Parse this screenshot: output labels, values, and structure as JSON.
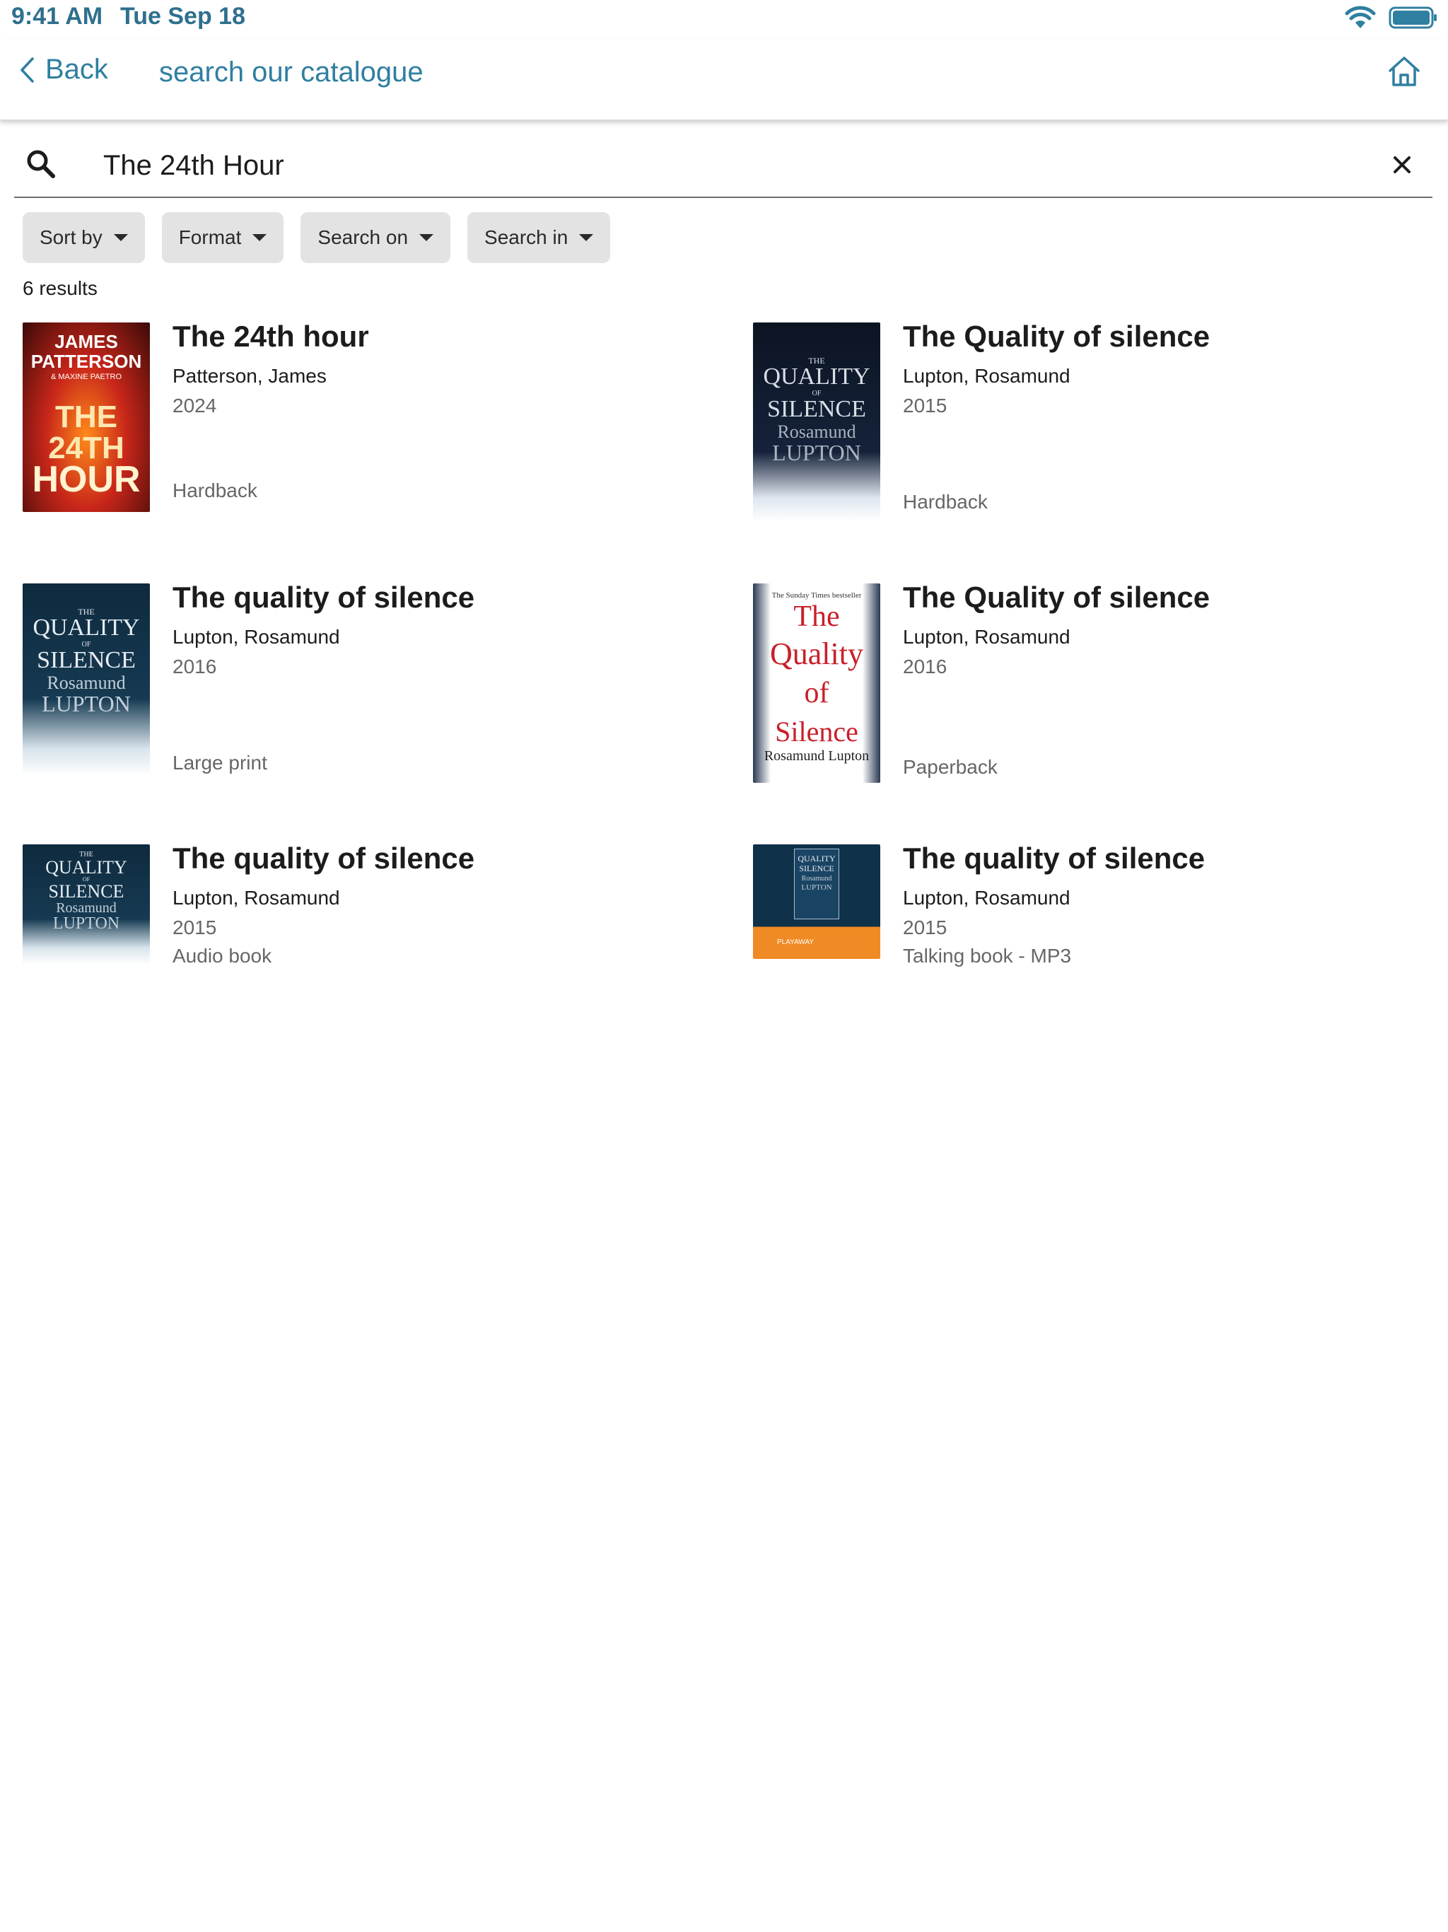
{
  "status_bar": {
    "time": "9:41 AM",
    "date": "Tue Sep 18",
    "wifi_icon": "wifi-icon",
    "battery_icon": "battery-icon"
  },
  "nav": {
    "back_label": "Back",
    "title": "search our catalogue",
    "home_icon": "home-icon"
  },
  "search": {
    "value": "The 24th Hour",
    "clear_icon": "close-icon"
  },
  "filters": [
    {
      "label": "Sort by"
    },
    {
      "label": "Format"
    },
    {
      "label": "Search on"
    },
    {
      "label": "Search in"
    }
  ],
  "results_count": "6 results",
  "results": [
    {
      "title": "The 24th hour",
      "author": "Patterson, James",
      "year": "2024",
      "format": "Hardback",
      "cover": {
        "line1": "JAMES",
        "line2": "PATTERSON",
        "line3": "& MAXINE PAETRO",
        "line4": "THE 24TH",
        "line5": "HOUR"
      }
    },
    {
      "title": "The Quality of silence",
      "author": "Lupton, Rosamund",
      "year": "2015",
      "format": "Hardback",
      "cover": {
        "line1": "THE",
        "line2": "QUALITY",
        "line3": "OF",
        "line4": "SILENCE",
        "line5": "Rosamund",
        "line6": "LUPTON"
      }
    },
    {
      "title": "The quality of silence",
      "author": "Lupton, Rosamund",
      "year": "2016",
      "format": "Large print",
      "cover": {
        "line1": "THE",
        "line2": "QUALITY",
        "line3": "OF",
        "line4": "SILENCE",
        "line5": "Rosamund",
        "line6": "LUPTON"
      }
    },
    {
      "title": "The Quality of silence",
      "author": "Lupton, Rosamund",
      "year": "2016",
      "format": "Paperback",
      "cover": {
        "line0": "The Sunday Times bestseller",
        "line1": "The",
        "line2": "Quality",
        "line3": "of",
        "line4": "Silence",
        "line5": "Rosamund Lupton"
      }
    },
    {
      "title": "The quality of silence",
      "author": "Lupton, Rosamund",
      "year": "2015",
      "format": "Audio book",
      "cover": {
        "line1": "THE",
        "line2": "QUALITY",
        "line3": "OF",
        "line4": "SILENCE",
        "line5": "Rosamund",
        "line6": "LUPTON"
      }
    },
    {
      "title": "The quality of silence",
      "author": "Lupton, Rosamund",
      "year": "2015",
      "format": "Talking book - MP3",
      "cover": {
        "line1": "QUALITY",
        "line2": "SILENCE",
        "line3": "Rosamund",
        "line4": "LUPTON",
        "line5": "PLAYAWAY"
      }
    }
  ],
  "colors": {
    "accent": "#2f7fa0",
    "chip_bg": "#e3e3e3",
    "secondary_text": "#666666"
  }
}
